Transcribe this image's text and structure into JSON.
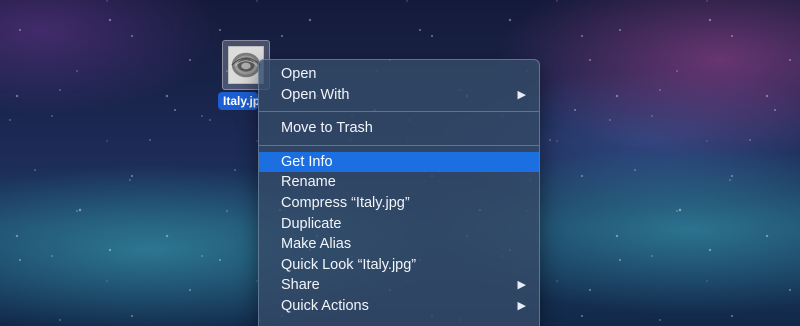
{
  "desktop": {
    "file": {
      "name_label": "Italy.jpg",
      "icon": "image-file-icon"
    }
  },
  "context_menu": {
    "groups": [
      [
        {
          "label": "Open",
          "submenu": false,
          "highlighted": false
        },
        {
          "label": "Open With",
          "submenu": true,
          "highlighted": false
        }
      ],
      [
        {
          "label": "Move to Trash",
          "submenu": false,
          "highlighted": false
        }
      ],
      [
        {
          "label": "Get Info",
          "submenu": false,
          "highlighted": true
        },
        {
          "label": "Rename",
          "submenu": false,
          "highlighted": false
        },
        {
          "label": "Compress “Italy.jpg”",
          "submenu": false,
          "highlighted": false
        },
        {
          "label": "Duplicate",
          "submenu": false,
          "highlighted": false
        },
        {
          "label": "Make Alias",
          "submenu": false,
          "highlighted": false
        },
        {
          "label": "Quick Look “Italy.jpg”",
          "submenu": false,
          "highlighted": false
        },
        {
          "label": "Share",
          "submenu": true,
          "highlighted": false
        },
        {
          "label": "Quick Actions",
          "submenu": true,
          "highlighted": false
        }
      ]
    ],
    "submenu_arrow": "▶",
    "highlight_color": "#1b6fe0"
  }
}
